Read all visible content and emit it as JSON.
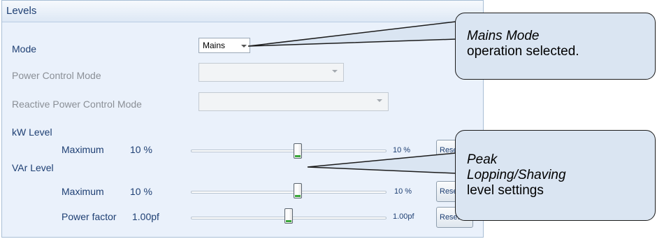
{
  "panel": {
    "title": "Levels"
  },
  "mode": {
    "label": "Mode",
    "value": "Mains"
  },
  "power_control_mode": {
    "label": "Power Control Mode",
    "value": ""
  },
  "reactive_power_control_mode": {
    "label": "Reactive Power Control Mode",
    "value": ""
  },
  "kw_level": {
    "section_label": "kW Level",
    "maximum_label": "Maximum",
    "maximum_value": "10 %",
    "slider_value_label": "10 %",
    "slider_fraction": 0.55
  },
  "var_level": {
    "section_label": "VAr Level",
    "maximum_label": "Maximum",
    "maximum_value": "10 %",
    "maximum_slider_value_label": "10 %",
    "maximum_slider_fraction": 0.55,
    "maximum_reset_label": "Reset",
    "power_factor_label": "Power factor",
    "power_factor_value": "1.00pf",
    "power_factor_slider_value_label": "1.00pf",
    "power_factor_slider_fraction": 0.5,
    "power_factor_reset_label": "Reset"
  },
  "kw_reset_label": "Reset",
  "callouts": {
    "mains_mode": {
      "line1": "Mains Mode",
      "line2": "operation selected."
    },
    "peak_lopping": {
      "line1": "Peak",
      "line2": "Lopping/Shaving",
      "line3": "level settings"
    }
  },
  "colors": {
    "panel_bg": "#eaf1fb",
    "label_text": "#1e3f73",
    "disabled_text": "#8a8f96",
    "callout_bg": "#dae5f2",
    "slider_thumb_accent": "#3aa63a"
  }
}
